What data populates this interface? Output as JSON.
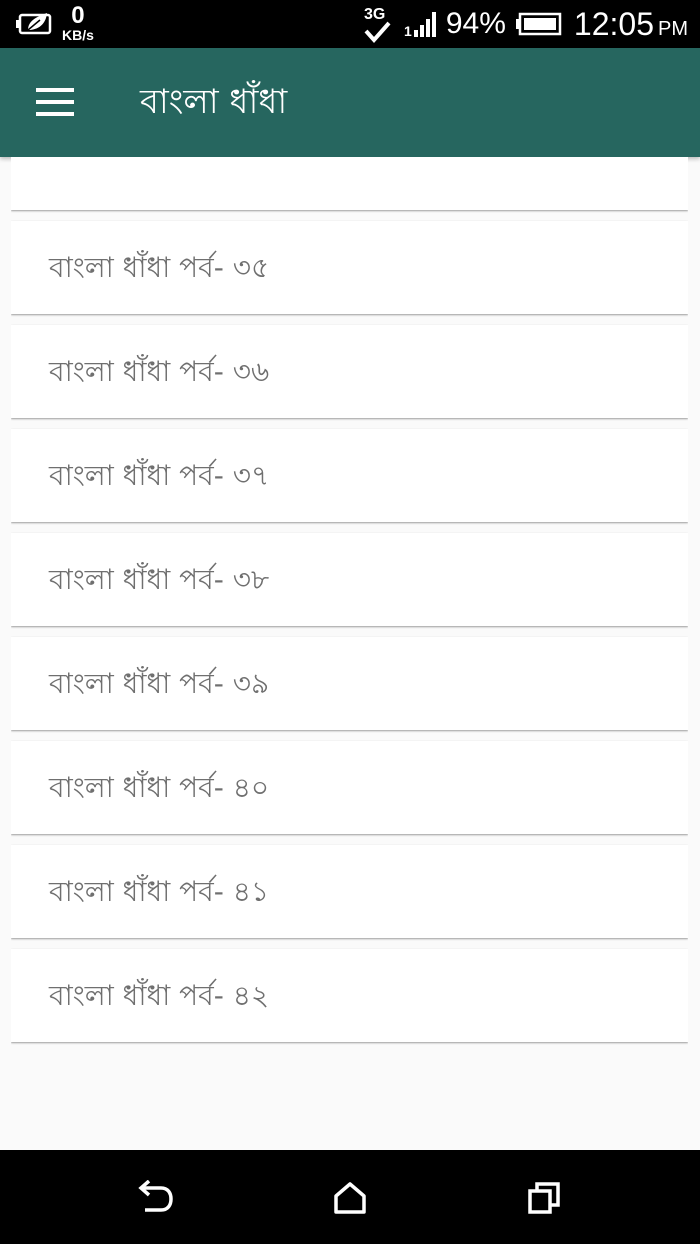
{
  "status_bar": {
    "eco_icon": "leaf-battery-icon",
    "data_speed": "0",
    "data_unit": "KB/s",
    "network_type": "3G",
    "signal_sim": "1",
    "battery_percent": "94%",
    "time": "12:05",
    "ampm": "PM"
  },
  "app_bar": {
    "title": "বাংলা ধাঁধা",
    "menu_icon": "hamburger-menu-icon",
    "color": "#26665f"
  },
  "list": {
    "items": [
      {
        "label": ""
      },
      {
        "label": "বাংলা ধাঁধা পর্ব- ৩৫"
      },
      {
        "label": "বাংলা ধাঁধা পর্ব- ৩৬"
      },
      {
        "label": "বাংলা ধাঁধা পর্ব- ৩৭"
      },
      {
        "label": "বাংলা ধাঁধা পর্ব- ৩৮"
      },
      {
        "label": "বাংলা ধাঁধা পর্ব- ৩৯"
      },
      {
        "label": "বাংলা ধাঁধা পর্ব- ৪০"
      },
      {
        "label": "বাংলা ধাঁধা পর্ব- ৪১"
      },
      {
        "label": "বাংলা ধাঁধা পর্ব- ৪২"
      }
    ]
  },
  "nav_bar": {
    "back_icon": "back-arrow-icon",
    "home_icon": "home-icon",
    "recents_icon": "recent-apps-icon"
  }
}
